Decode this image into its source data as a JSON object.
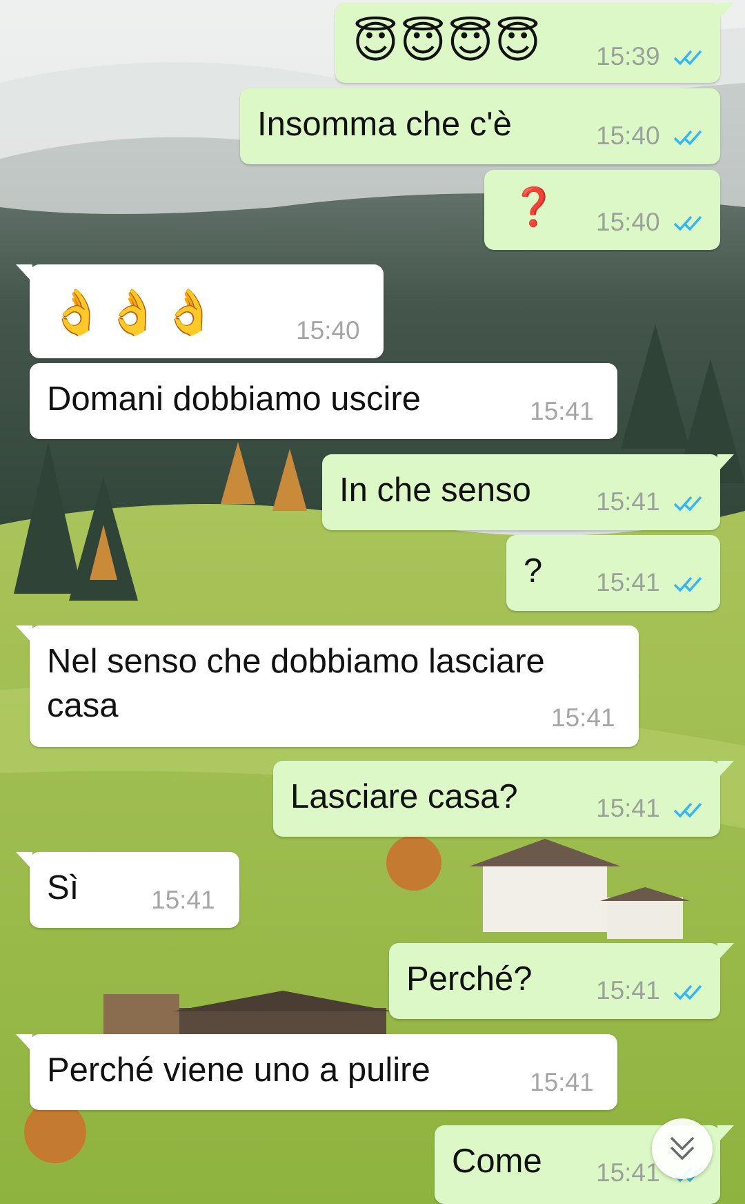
{
  "wallpaper": {
    "description_colors": {
      "sky": "#e9eceb",
      "forest": "#3f5148",
      "meadow": "#9fbf52"
    }
  },
  "colors": {
    "outgoing_bubble": "#dcf8c6",
    "incoming_bubble": "#ffffff",
    "read_ticks": "#34b7f1"
  },
  "messages": [
    {
      "dir": "out",
      "text": "😇😇😇😇",
      "time": "15:39",
      "status": "read"
    },
    {
      "dir": "out",
      "text": "Insomma che c'è",
      "time": "15:40",
      "status": "read"
    },
    {
      "dir": "out",
      "text": "❓",
      "time": "15:40",
      "status": "read"
    },
    {
      "dir": "in",
      "text": "👌👌👌",
      "time": "15:40"
    },
    {
      "dir": "in",
      "text": "Domani dobbiamo uscire",
      "time": "15:41"
    },
    {
      "dir": "out",
      "text": "In che senso",
      "time": "15:41",
      "status": "read"
    },
    {
      "dir": "out",
      "text": "?",
      "time": "15:41",
      "status": "read"
    },
    {
      "dir": "in",
      "text_line1": "Nel senso che dobbiamo lasciare",
      "text_line2": "casa",
      "time": "15:41"
    },
    {
      "dir": "out",
      "text": "Lasciare casa?",
      "time": "15:41",
      "status": "read"
    },
    {
      "dir": "in",
      "text": "Sì",
      "time": "15:41"
    },
    {
      "dir": "out",
      "text": "Perché?",
      "time": "15:41",
      "status": "read"
    },
    {
      "dir": "in",
      "text": "Perché viene uno a pulire",
      "time": "15:41"
    },
    {
      "dir": "out",
      "text": "Come",
      "time": "15:41",
      "status": "read"
    }
  ],
  "scroll_button": {
    "icon": "double-chevron-down-icon"
  }
}
